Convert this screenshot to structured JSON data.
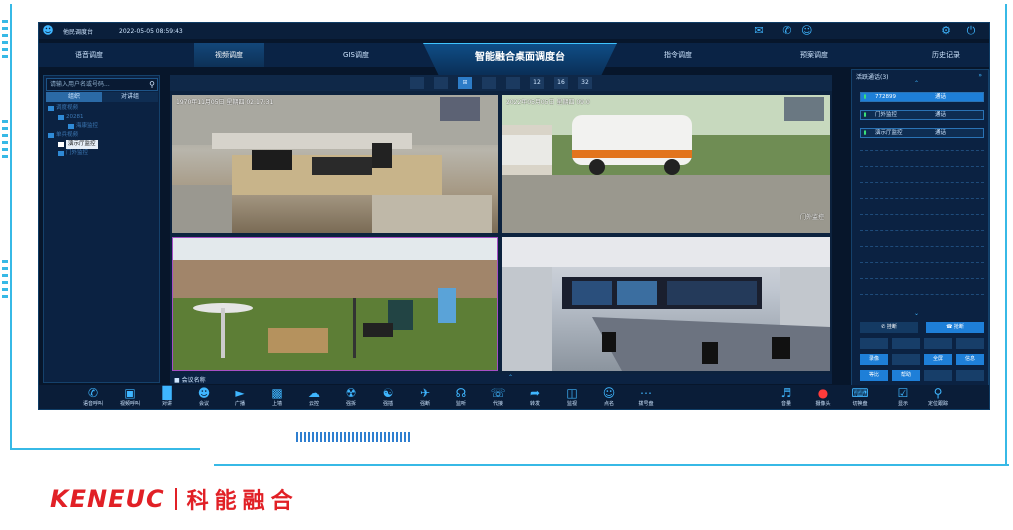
{
  "topbar": {
    "user_label": "他民调度台",
    "time": "2022-05-05 08:59:43"
  },
  "nav": {
    "title": "智能融合桌面调度台",
    "items": [
      {
        "label": "语音调度"
      },
      {
        "label": "视频调度"
      },
      {
        "label": "GIS调度"
      },
      {
        "label": "指令调度"
      },
      {
        "label": "预案调度"
      },
      {
        "label": "历史记录"
      }
    ]
  },
  "left": {
    "search_placeholder": "请输入用户名或号码...",
    "tabs": [
      "组织",
      "对讲组"
    ],
    "tree": [
      {
        "label": "调度视频"
      },
      {
        "label": "20281"
      },
      {
        "label": "海康监控"
      },
      {
        "label": "单兵视频"
      },
      {
        "label": "演示厅监控"
      },
      {
        "label": "门外监控"
      }
    ]
  },
  "video": {
    "layouts": [
      "12",
      "16",
      "32"
    ],
    "tiles": [
      {
        "timestamp": "1970年11月05日 星期四 02:17:31",
        "caption": ""
      },
      {
        "timestamp": "2022年05月05日 星期四 09:0",
        "caption": "门外监控"
      },
      {
        "timestamp": "",
        "caption": ""
      },
      {
        "timestamp": "",
        "caption": ""
      }
    ]
  },
  "right": {
    "header": "活跃通话(3)",
    "calls": [
      {
        "name": "772899",
        "status": "通话",
        "active": true
      },
      {
        "name": "门外监控",
        "status": "通话",
        "active": false
      },
      {
        "name": "演示厅监控",
        "status": "通话",
        "active": false
      }
    ],
    "buttons": {
      "hangup": "挂断",
      "grab": "抢断",
      "record": "录像",
      "fullscreen": "全屏",
      "info": "信息",
      "wait": "等比",
      "help": "帮助"
    }
  },
  "meeting": {
    "label": "会议名称"
  },
  "toolbar": {
    "left_tools": [
      {
        "label": "语音呼叫",
        "icon": "phone-icon"
      },
      {
        "label": "视频呼叫",
        "icon": "video-call-icon"
      },
      {
        "label": "对讲",
        "icon": "intercom-icon"
      },
      {
        "label": "会议",
        "icon": "meeting-icon"
      },
      {
        "label": "广播",
        "icon": "broadcast-icon"
      },
      {
        "label": "上墙",
        "icon": "wall-icon"
      },
      {
        "label": "云控",
        "icon": "cloud-icon"
      },
      {
        "label": "强拆",
        "icon": "force-icon"
      },
      {
        "label": "强插",
        "icon": "insert-icon"
      },
      {
        "label": "强断",
        "icon": "disconnect-icon"
      },
      {
        "label": "监听",
        "icon": "headset-icon"
      },
      {
        "label": "代接",
        "icon": "pickup-icon"
      },
      {
        "label": "转发",
        "icon": "forward-icon"
      },
      {
        "label": "监视",
        "icon": "monitor-icon"
      },
      {
        "label": "点名",
        "icon": "rollcall-icon"
      },
      {
        "label": "拨号盘",
        "icon": "dialpad-icon"
      }
    ],
    "right_tools": [
      {
        "label": "音量",
        "icon": "volume-icon"
      },
      {
        "label": "摄像头",
        "icon": "camera-icon"
      },
      {
        "label": "切换盘",
        "icon": "switch-icon"
      },
      {
        "label": "显示",
        "icon": "display-icon"
      },
      {
        "label": "定位跟踪",
        "icon": "locate-icon"
      }
    ]
  },
  "brand": {
    "en": "KENEUC",
    "cn": "科能融合"
  },
  "colors": {
    "accent": "#3fb6ff",
    "active": "#1e7fd8",
    "brand": "#e12026"
  }
}
